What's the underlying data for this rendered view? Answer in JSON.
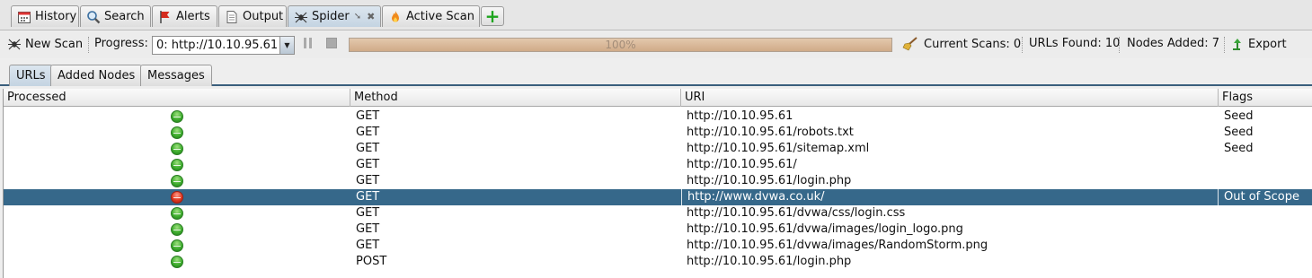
{
  "tabs": [
    {
      "label": "History",
      "icon": "calendar-icon"
    },
    {
      "label": "Search",
      "icon": "magnifier-icon"
    },
    {
      "label": "Alerts",
      "icon": "flag-icon"
    },
    {
      "label": "Output",
      "icon": "document-icon"
    },
    {
      "label": "Spider",
      "icon": "spider-icon"
    },
    {
      "label": "Active Scan",
      "icon": "flame-icon"
    }
  ],
  "toolbar": {
    "new_scan": "New Scan",
    "progress_label": "Progress:",
    "progress_select": "0: http://10.10.95.61",
    "progress_text": "100%",
    "progress_value": 1.0,
    "current_scans": "Current Scans: 0",
    "urls_found": "URLs Found: 10",
    "nodes_added": "Nodes Added: 7",
    "export": "Export"
  },
  "subtabs": [
    "URLs",
    "Added Nodes",
    "Messages"
  ],
  "table": {
    "headers": [
      "Processed",
      "Method",
      "URI",
      "Flags"
    ],
    "rows": [
      {
        "processed": "ok",
        "method": "GET",
        "uri": "http://10.10.95.61",
        "flags": "Seed"
      },
      {
        "processed": "ok",
        "method": "GET",
        "uri": "http://10.10.95.61/robots.txt",
        "flags": "Seed"
      },
      {
        "processed": "ok",
        "method": "GET",
        "uri": "http://10.10.95.61/sitemap.xml",
        "flags": "Seed"
      },
      {
        "processed": "ok",
        "method": "GET",
        "uri": "http://10.10.95.61/",
        "flags": ""
      },
      {
        "processed": "ok",
        "method": "GET",
        "uri": "http://10.10.95.61/login.php",
        "flags": ""
      },
      {
        "processed": "bad",
        "method": "GET",
        "uri": "http://www.dvwa.co.uk/",
        "flags": "Out of Scope"
      },
      {
        "processed": "ok",
        "method": "GET",
        "uri": "http://10.10.95.61/dvwa/css/login.css",
        "flags": ""
      },
      {
        "processed": "ok",
        "method": "GET",
        "uri": "http://10.10.95.61/dvwa/images/login_logo.png",
        "flags": ""
      },
      {
        "processed": "ok",
        "method": "GET",
        "uri": "http://10.10.95.61/dvwa/images/RandomStorm.png",
        "flags": ""
      },
      {
        "processed": "ok",
        "method": "POST",
        "uri": "http://10.10.95.61/login.php",
        "flags": ""
      }
    ]
  },
  "colors": {
    "selected_row": "#36688a",
    "progress_fill": "#d8b89a",
    "processed_ok": "#3fae2f",
    "processed_bad": "#e03a22"
  }
}
